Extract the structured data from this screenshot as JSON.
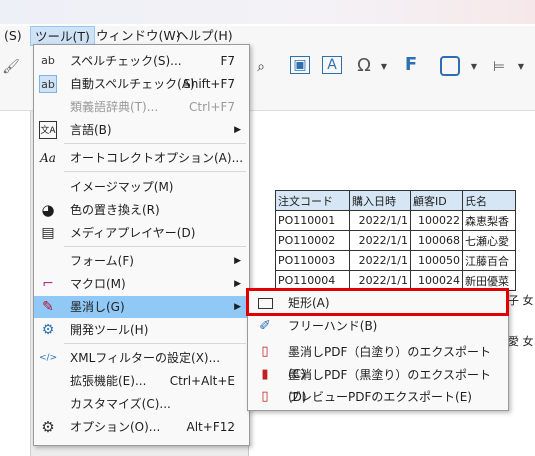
{
  "menubar": {
    "items": [
      "(S)",
      "ツール(T)",
      "ウィンドウ(W)",
      "ヘルプ(H)"
    ]
  },
  "toolbar": {
    "font_glyph": "F",
    "omega_glyph": "Ω"
  },
  "menu": {
    "items": [
      {
        "label": "スペルチェック(S)...",
        "shortcut": "F7",
        "icon": "spellcheck-icon",
        "glyph": "ab"
      },
      {
        "label": "自動スペルチェック(A)",
        "shortcut": "Shift+F7",
        "icon": "auto-spellcheck-icon",
        "glyph": "ab"
      },
      {
        "label": "類義語辞典(T)...",
        "shortcut": "Ctrl+F7",
        "icon": "thesaurus-icon",
        "glyph": ""
      },
      {
        "label": "言語(B)",
        "shortcut": "",
        "icon": "language-icon",
        "glyph": "文A"
      },
      {
        "label": "オートコレクトオプション(A)...",
        "shortcut": "",
        "icon": "autocorrect-icon",
        "glyph": "Aa"
      },
      {
        "label": "イメージマップ(M)",
        "shortcut": "",
        "icon": "imagemap-icon",
        "glyph": ""
      },
      {
        "label": "色の置き換え(R)",
        "shortcut": "",
        "icon": "palette-icon",
        "glyph": "◕"
      },
      {
        "label": "メディアプレイヤー(D)",
        "shortcut": "",
        "icon": "media-player-icon",
        "glyph": "▤"
      },
      {
        "label": "フォーム(F)",
        "shortcut": "",
        "icon": "form-icon",
        "glyph": ""
      },
      {
        "label": "マクロ(M)",
        "shortcut": "",
        "icon": "macro-icon",
        "glyph": "⌐"
      },
      {
        "label": "墨消し(G)",
        "shortcut": "",
        "icon": "redact-icon",
        "glyph": "✎"
      },
      {
        "label": "開発ツール(H)",
        "shortcut": "",
        "icon": "dev-tools-icon",
        "glyph": "⚙"
      },
      {
        "label": "XMLフィルターの設定(X)...",
        "shortcut": "",
        "icon": "xml-filter-icon",
        "glyph": "</>"
      },
      {
        "label": "拡張機能(E)...",
        "shortcut": "Ctrl+Alt+E",
        "icon": "",
        "glyph": ""
      },
      {
        "label": "カスタマイズ(C)...",
        "shortcut": "",
        "icon": "",
        "glyph": ""
      },
      {
        "label": "オプション(O)...",
        "shortcut": "Alt+F12",
        "icon": "options-gear-icon",
        "glyph": "⚙"
      }
    ]
  },
  "submenu": {
    "items": [
      {
        "label": "矩形(A)",
        "icon": "rectangle-icon"
      },
      {
        "label": "フリーハンド(B)",
        "icon": "freehand-icon"
      },
      {
        "label": "墨消しPDF（白塗り）のエクスポート(C)",
        "icon": "pdf-white-icon"
      },
      {
        "label": "墨消しPDF（黒塗り）のエクスポート(D)",
        "icon": "pdf-black-icon"
      },
      {
        "label": "プレビューPDFのエクスポート(E)",
        "icon": "pdf-preview-icon"
      }
    ]
  },
  "document": {
    "header": [
      "注文コード",
      "購入日時",
      "顧客ID",
      "氏名"
    ],
    "rows": [
      [
        "PO110001",
        "2022/1/1",
        "100022",
        "森恵梨香"
      ],
      [
        "PO110002",
        "2022/1/1",
        "100068",
        "七瀬心愛"
      ],
      [
        "PO110003",
        "2022/1/1",
        "100050",
        "江藤百合"
      ],
      [
        "PO110004",
        "2022/1/1",
        "100024",
        "新田優菜"
      ]
    ],
    "overflow_text": [
      "子 女",
      "愛 女"
    ]
  }
}
